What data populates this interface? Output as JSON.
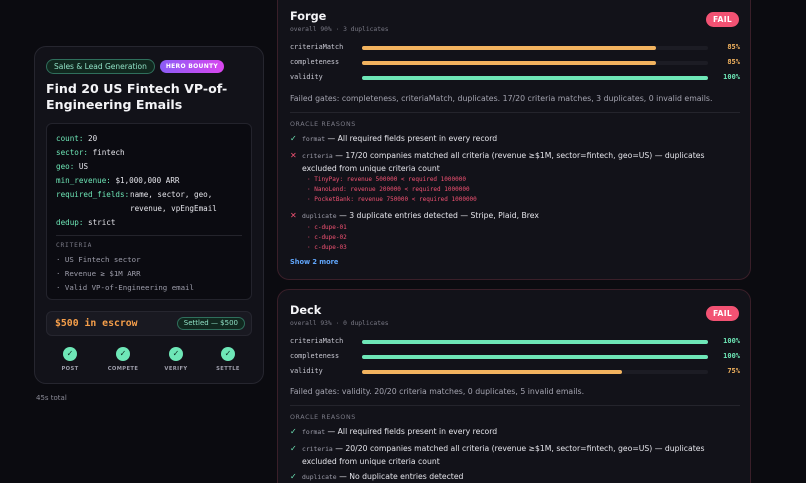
{
  "bounty": {
    "category": "Sales & Lead Generation",
    "hero_badge": "HERO BOUNTY",
    "title": "Find 20 US Fintech VP-of-Engineering Emails",
    "spec": {
      "count_key": "count:",
      "count_val": "20",
      "sector_key": "sector:",
      "sector_val": "fintech",
      "geo_key": "geo:",
      "geo_val": "US",
      "min_revenue_key": "min_revenue:",
      "min_revenue_val": "$1,000,000 ARR",
      "required_fields_key": "required_fields:",
      "required_fields_val": "name, sector, geo, revenue, vpEngEmail",
      "dedup_key": "dedup:",
      "dedup_val": "strict"
    },
    "criteria_heading": "CRITERIA",
    "criteria": [
      "· US Fintech sector",
      "· Revenue ≥ $1M ARR",
      "· Valid VP-of-Engineering email"
    ],
    "escrow": "$500 in escrow",
    "settled": "Settled — $500",
    "steps": [
      "POST",
      "COMPETE",
      "VERIFY",
      "SETTLE"
    ],
    "total_time": "45s total"
  },
  "forge": {
    "name": "Forge",
    "subtitle": "overall 90% · 3 duplicates",
    "status": "FAIL",
    "metrics": [
      {
        "label": "criteriaMatch",
        "value": 0.85,
        "display": "85%",
        "color": "#f2b35f"
      },
      {
        "label": "completeness",
        "value": 0.85,
        "display": "85%",
        "color": "#f2b35f"
      },
      {
        "label": "validity",
        "value": 1.0,
        "display": "100%",
        "color": "#6ee7b7"
      }
    ],
    "gates": "Failed gates: completeness, criteriaMatch, duplicates. 17/20 criteria matches, 3 duplicates, 0 invalid emails.",
    "oracle_heading": "ORACLE REASONS",
    "reasons": [
      {
        "icon": "✓",
        "code": "format",
        "text": " — All required fields present in every record"
      },
      {
        "icon": "✕",
        "code": "criteria",
        "text": " — 17/20 companies matched all criteria (revenue ≥$1M, sector=fintech, geo=US) — duplicates excluded from unique criteria count"
      },
      {
        "icon": "✕",
        "code": "duplicate",
        "text": " — 3 duplicate entries detected — Stripe, Plaid, Brex"
      }
    ],
    "criteria_details": [
      "· TinyPay: revenue 500000 < required 1000000",
      "· NanoLend: revenue 200000 < required 1000000",
      "· PocketBank: revenue 750000 < required 1000000"
    ],
    "duplicate_details": [
      "· c-dupe-01",
      "· c-dupe-02",
      "· c-dupe-03"
    ],
    "show_more": "Show 2 more"
  },
  "deck": {
    "name": "Deck",
    "subtitle": "overall 93% · 0 duplicates",
    "status": "FAIL",
    "metrics": [
      {
        "label": "criteriaMatch",
        "value": 1.0,
        "display": "100%",
        "color": "#6ee7b7"
      },
      {
        "label": "completeness",
        "value": 1.0,
        "display": "100%",
        "color": "#6ee7b7"
      },
      {
        "label": "validity",
        "value": 0.75,
        "display": "75%",
        "color": "#f2b35f"
      }
    ],
    "gates": "Failed gates: validity. 20/20 criteria matches, 0 duplicates, 5 invalid emails.",
    "oracle_heading": "ORACLE REASONS",
    "reasons": [
      {
        "icon": "✓",
        "code": "format",
        "text": " — All required fields present in every record"
      },
      {
        "icon": "✓",
        "code": "criteria",
        "text": " — 20/20 companies matched all criteria (revenue ≥$1M, sector=fintech, geo=US) — duplicates excluded from unique criteria count"
      },
      {
        "icon": "✓",
        "code": "duplicate",
        "text": " — No duplicate entries detected"
      }
    ]
  },
  "colors": {
    "pass": "#6ee7b7",
    "fail": "#f25273",
    "warn": "#f2b35f",
    "accent": "#f59e4a"
  }
}
